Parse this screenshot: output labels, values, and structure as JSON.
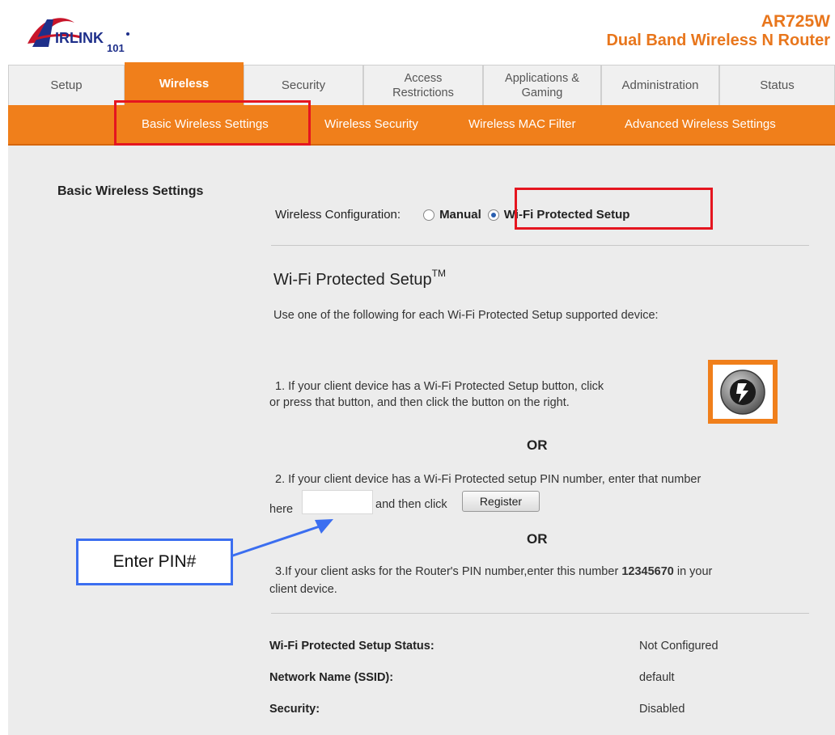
{
  "brand": {
    "logo_text": "AIRLINK 101",
    "model": "AR725W",
    "product": "Dual Band Wireless N Router",
    "accent_color": "#f07f1b"
  },
  "tabs": [
    {
      "label": "Setup",
      "active": false
    },
    {
      "label": "Wireless",
      "active": true
    },
    {
      "label": "Security",
      "active": false
    },
    {
      "label": "Access\nRestrictions",
      "active": false
    },
    {
      "label": "Applications &\nGaming",
      "active": false
    },
    {
      "label": "Administration",
      "active": false
    },
    {
      "label": "Status",
      "active": false
    }
  ],
  "subnav": [
    {
      "label": "Basic Wireless Settings",
      "active": true
    },
    {
      "label": "Wireless Security",
      "active": false
    },
    {
      "label": "Wireless MAC Filter",
      "active": false
    },
    {
      "label": "Advanced Wireless Settings",
      "active": false
    }
  ],
  "section_title": "Basic Wireless Settings",
  "config": {
    "label": "Wireless Configuration:",
    "options": [
      {
        "label": "Manual",
        "selected": false
      },
      {
        "label": "Wi-Fi Protected Setup",
        "selected": true
      }
    ]
  },
  "wps": {
    "title": "Wi-Fi Protected Setup",
    "title_sup": "TM",
    "intro": "Use one of the following for each Wi-Fi Protected Setup supported device:",
    "step1_line1": "1. If your client device has a Wi-Fi Protected Setup button, click",
    "step1_line2": "or press that button, and then click the button on the right.",
    "or_label": "OR",
    "step2_line1": "2. If your client device has a Wi-Fi Protected setup PIN number, enter that number",
    "step2_here": "here",
    "step2_then": "and then click",
    "pin_value": "",
    "register_label": "Register",
    "step3_pre": "3.If your client asks for the Router's PIN number,enter this number",
    "router_pin": "12345670",
    "step3_post": "in your",
    "step3_line2": "client device.",
    "wps_button_icon": "wps-sync-icon"
  },
  "status": [
    {
      "label": "Wi-Fi Protected Setup Status:",
      "value": "Not Configured"
    },
    {
      "label": "Network Name (SSID):",
      "value": "default"
    },
    {
      "label": "Security:",
      "value": "Disabled"
    }
  ],
  "annotation": {
    "callout_text": "Enter PIN#",
    "highlight_color": "#e5151f",
    "callout_color": "#3b6ef0"
  }
}
